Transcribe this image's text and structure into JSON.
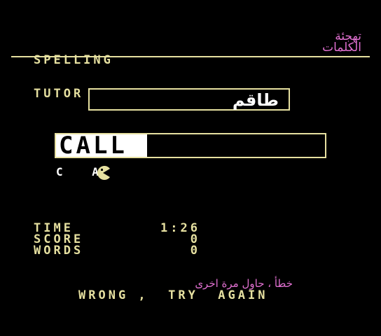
{
  "header": {
    "title_line1": "SPELLING",
    "title_line2": "TUTOR",
    "title_ar_line1": "تهجئة",
    "title_ar_line2": "الكلمات"
  },
  "prompt": {
    "arabic_word": "طاقم"
  },
  "answer": {
    "typed_word": "CALL",
    "letters_entered": "C A"
  },
  "stats": {
    "time_label": "TIME",
    "time_value": "1:26",
    "score_label": "SCORE",
    "score_value": "0",
    "words_label": "WORDS",
    "words_value": "0"
  },
  "message": {
    "arabic": "خطأ ، حاول مرة اخرى",
    "english": "WRONG ,  TRY  AGAIN"
  },
  "colors": {
    "background": "#000000",
    "primary": "#e6e0a0",
    "accent": "#e070d0",
    "highlight": "#ffffff"
  },
  "icons": {
    "cursor": "pacman-icon"
  }
}
